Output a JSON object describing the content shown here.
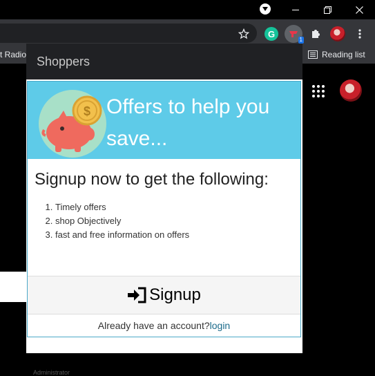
{
  "popup": {
    "header_title": "Shoppers",
    "banner_text": "Offers to help you save...",
    "subtitle": "Signup now to get the following:",
    "offers": [
      "Timely offers",
      "shop Objectively",
      "fast and free information on offers"
    ],
    "signup_label": "Signup",
    "login_prompt": "Already have an account?",
    "login_link": "login"
  },
  "bookmarks": {
    "left_item": "t Radio",
    "reading_list": "Reading list"
  },
  "extensions": {
    "badge_count": "1"
  },
  "page": {
    "bottom_text": "Administrator"
  },
  "icons": [
    "download-icon",
    "minimize-icon",
    "restore-icon",
    "close-icon",
    "star-icon",
    "grammarly-icon",
    "shoppers-extension-icon",
    "puzzle-icon",
    "profile-avatar",
    "menu-icon",
    "reading-list-icon",
    "apps-grid-icon",
    "piggy-bank-icon",
    "signup-icon"
  ],
  "colors": {
    "banner": "#5ecbe8",
    "header": "#202124",
    "link": "#1a6a8a",
    "grammarly": "#15c39a"
  }
}
